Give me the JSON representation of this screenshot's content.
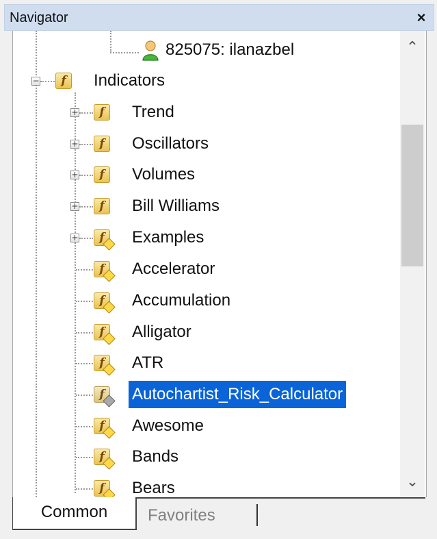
{
  "window": {
    "title": "Navigator",
    "close_label": "×"
  },
  "tree": {
    "account_label": "825075: ilanazbel",
    "indicators_label": "Indicators",
    "folders": [
      {
        "label": "Trend",
        "toggle": "+",
        "icon": "function-folder-icon"
      },
      {
        "label": "Oscillators",
        "toggle": "+",
        "icon": "function-folder-icon"
      },
      {
        "label": "Volumes",
        "toggle": "+",
        "icon": "function-folder-icon"
      },
      {
        "label": "Bill Williams",
        "toggle": "+",
        "icon": "function-folder-icon"
      },
      {
        "label": "Examples",
        "toggle": "+",
        "icon": "custom-indicator-icon"
      }
    ],
    "items": [
      {
        "label": "Accelerator"
      },
      {
        "label": "Accumulation"
      },
      {
        "label": "Alligator"
      },
      {
        "label": "ATR"
      },
      {
        "label": "Autochartist_Risk_Calculator",
        "selected": true
      },
      {
        "label": "Awesome"
      },
      {
        "label": "Bands"
      },
      {
        "label": "Bears"
      }
    ],
    "indicators_toggle": "−",
    "function_glyph": "f"
  },
  "scrollbar": {
    "up_glyph": "⌃",
    "down_glyph": "⌄"
  },
  "tabs": [
    {
      "label": "Common",
      "active": true
    },
    {
      "label": "Favorites",
      "active": false
    }
  ],
  "colors": {
    "selection": "#0a64d8",
    "titlebar": "#cfddef",
    "icon_gold": "#e9c353"
  }
}
